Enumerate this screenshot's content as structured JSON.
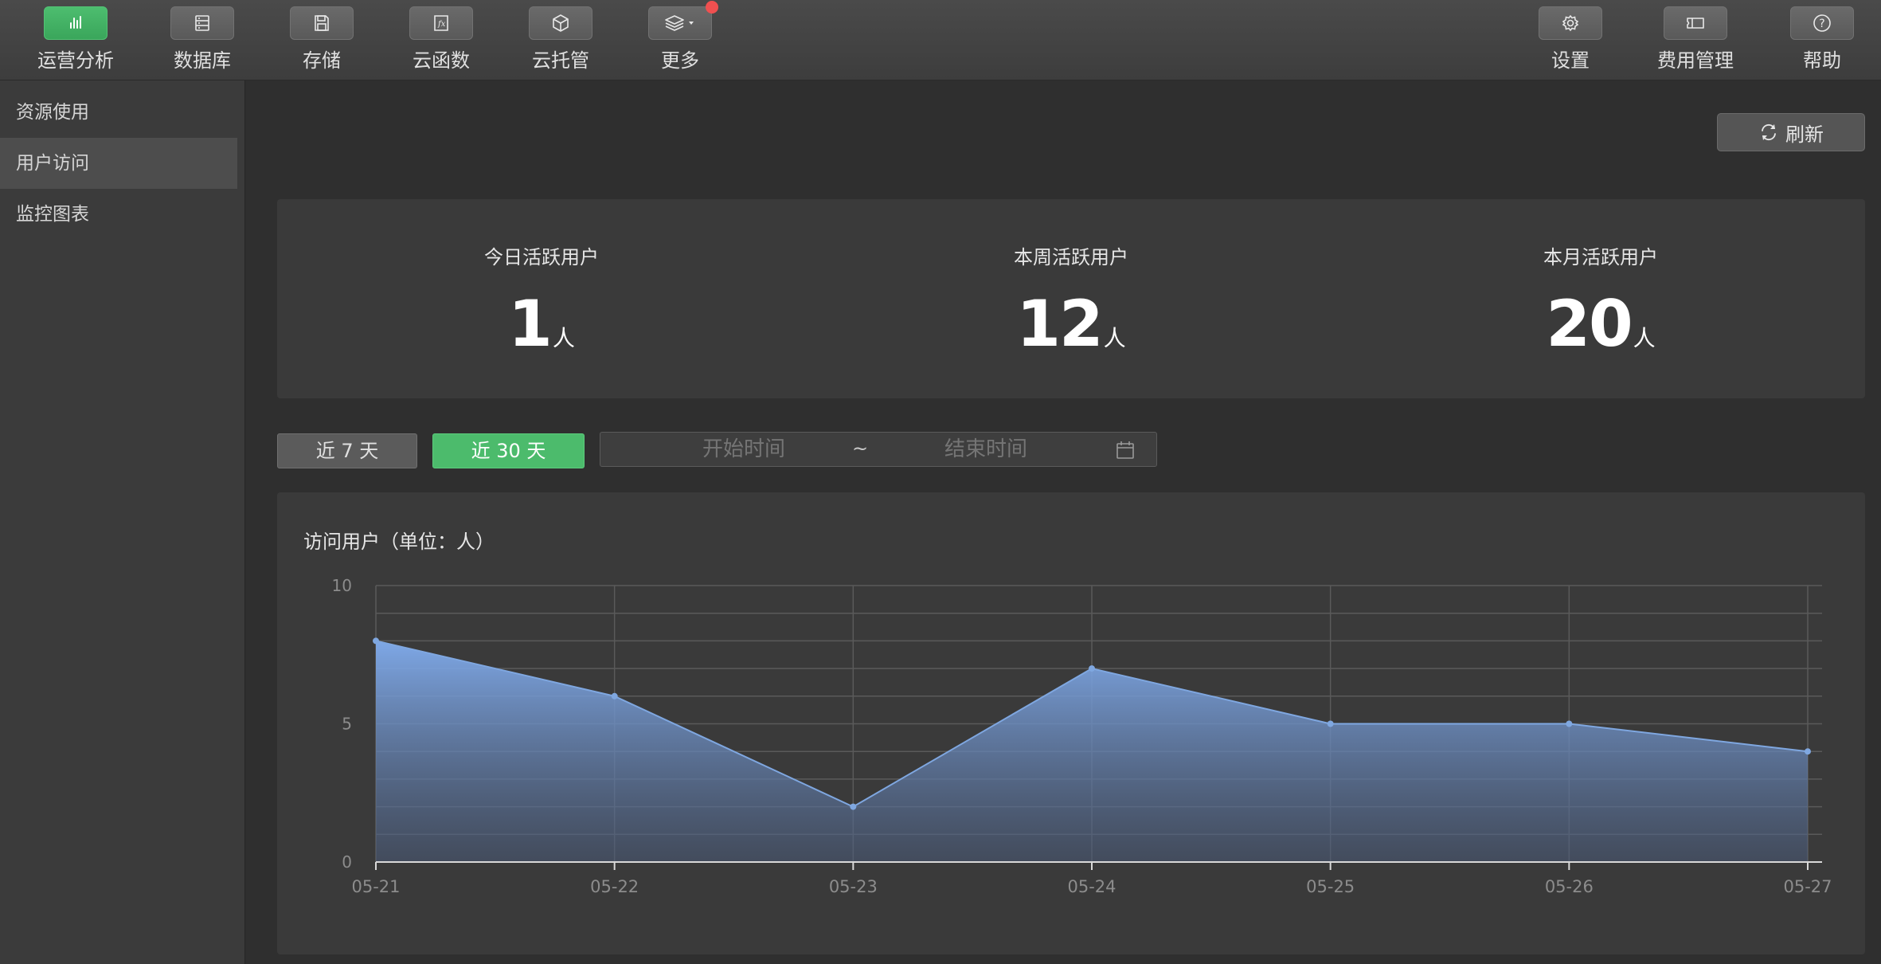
{
  "toolbar": {
    "left_items": [
      {
        "label": "运营分析",
        "icon": "bar-chart-icon",
        "active": true
      },
      {
        "label": "数据库",
        "icon": "database-icon",
        "active": false
      },
      {
        "label": "存储",
        "icon": "floppy-disk-icon",
        "active": false
      },
      {
        "label": "云函数",
        "icon": "function-icon",
        "active": false
      },
      {
        "label": "云托管",
        "icon": "cube-icon",
        "active": false
      },
      {
        "label": "更多",
        "icon": "layers-dropdown-icon",
        "active": false,
        "badge": true
      }
    ],
    "right_items": [
      {
        "label": "设置",
        "icon": "gear-icon"
      },
      {
        "label": "费用管理",
        "icon": "ticket-icon"
      },
      {
        "label": "帮助",
        "icon": "question-icon"
      }
    ]
  },
  "sidebar": {
    "items": [
      {
        "label": "资源使用",
        "active": false
      },
      {
        "label": "用户访问",
        "active": true
      },
      {
        "label": "监控图表",
        "active": false
      }
    ]
  },
  "refresh": {
    "label": "刷新",
    "icon": "refresh-icon"
  },
  "stats": [
    {
      "title": "今日活跃用户",
      "value": "1",
      "unit": "人"
    },
    {
      "title": "本周活跃用户",
      "value": "12",
      "unit": "人"
    },
    {
      "title": "本月活跃用户",
      "value": "20",
      "unit": "人"
    }
  ],
  "range": {
    "last7": "近 7 天",
    "last30": "近 30 天",
    "selected": "last30"
  },
  "date_picker": {
    "start_placeholder": "开始时间",
    "separator": "~",
    "end_placeholder": "结束时间",
    "icon": "calendar-icon"
  },
  "colors": {
    "accent_green": "#4cbb6c",
    "series_line": "#7fa7e0",
    "badge_red": "#f05050"
  },
  "chart_data": {
    "type": "area",
    "title": "访问用户（单位：人）",
    "x": [
      "05-21",
      "05-22",
      "05-23",
      "05-24",
      "05-25",
      "05-26",
      "05-27"
    ],
    "series": [
      {
        "values": [
          8,
          6,
          2,
          7,
          5,
          5,
          4
        ]
      }
    ],
    "ylim": [
      0,
      10
    ],
    "yticks": [
      0,
      5,
      10
    ],
    "grid": true,
    "legend": "none"
  }
}
